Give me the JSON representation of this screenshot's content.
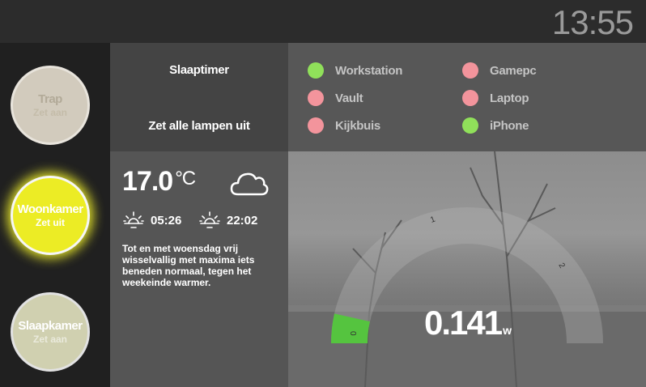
{
  "header": {
    "time": "13:55"
  },
  "rooms": [
    {
      "name": "Trap",
      "action": "Zet aan",
      "state": "off"
    },
    {
      "name": "Woonkamer",
      "action": "Zet uit",
      "state": "on"
    },
    {
      "name": "Slaapkamer",
      "action": "Zet aan",
      "state": "off"
    }
  ],
  "actions": {
    "sleep_timer": "Slaaptimer",
    "all_off": "Zet alle lampen uit"
  },
  "devices": [
    {
      "name": "Workstation",
      "status": "online",
      "color": "#90e05a"
    },
    {
      "name": "Gamepc",
      "status": "offline",
      "color": "#f3949c"
    },
    {
      "name": "Vault",
      "status": "offline",
      "color": "#f3949c"
    },
    {
      "name": "Laptop",
      "status": "offline",
      "color": "#f3949c"
    },
    {
      "name": "Kijkbuis",
      "status": "offline",
      "color": "#f3949c"
    },
    {
      "name": "iPhone",
      "status": "online",
      "color": "#90e05a"
    }
  ],
  "weather": {
    "temperature": "17.0",
    "unit": "°C",
    "icon": "cloud-icon",
    "sunrise": "05:26",
    "sunset": "22:02",
    "forecast": "Tot en met woensdag vrij wisselvallig met maxima iets beneden normaal, tegen het weekeinde warmer."
  },
  "power_gauge": {
    "value": "0.141",
    "unit": "w",
    "min_label": "0",
    "tick_1": "1",
    "tick_2": "2",
    "fill_fraction": 0.07,
    "fill_color": "#55c43f"
  }
}
